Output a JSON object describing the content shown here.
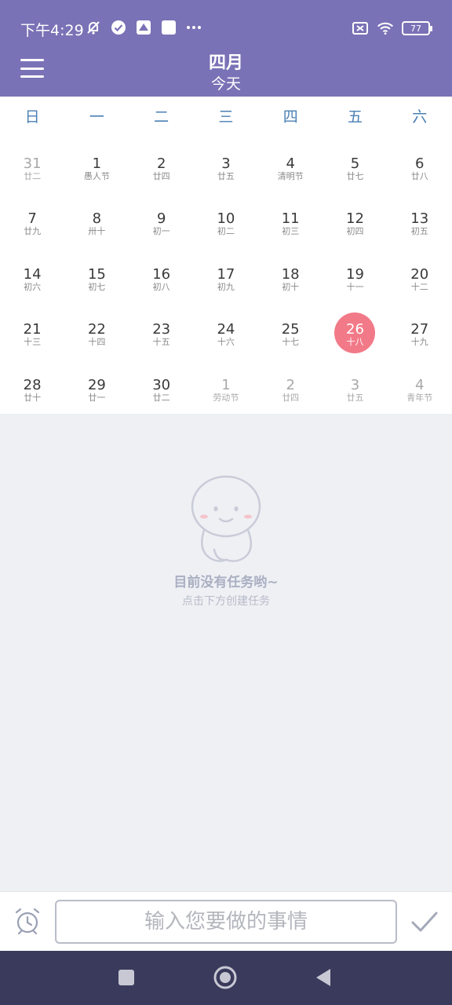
{
  "status": {
    "time": "下午4:29",
    "battery": "77"
  },
  "header": {
    "month_title": "四月",
    "today_label": "今天"
  },
  "weekdays": [
    "日",
    "一",
    "二",
    "三",
    "四",
    "五",
    "六"
  ],
  "calendar": {
    "weeks": [
      [
        {
          "day": "31",
          "lunar": "廿二",
          "other": true
        },
        {
          "day": "1",
          "lunar": "愚人节"
        },
        {
          "day": "2",
          "lunar": "廿四"
        },
        {
          "day": "3",
          "lunar": "廿五"
        },
        {
          "day": "4",
          "lunar": "清明节"
        },
        {
          "day": "5",
          "lunar": "廿七"
        },
        {
          "day": "6",
          "lunar": "廿八"
        }
      ],
      [
        {
          "day": "7",
          "lunar": "廿九"
        },
        {
          "day": "8",
          "lunar": "卅十"
        },
        {
          "day": "9",
          "lunar": "初一"
        },
        {
          "day": "10",
          "lunar": "初二"
        },
        {
          "day": "11",
          "lunar": "初三"
        },
        {
          "day": "12",
          "lunar": "初四"
        },
        {
          "day": "13",
          "lunar": "初五"
        }
      ],
      [
        {
          "day": "14",
          "lunar": "初六"
        },
        {
          "day": "15",
          "lunar": "初七"
        },
        {
          "day": "16",
          "lunar": "初八"
        },
        {
          "day": "17",
          "lunar": "初九"
        },
        {
          "day": "18",
          "lunar": "初十"
        },
        {
          "day": "19",
          "lunar": "十一"
        },
        {
          "day": "20",
          "lunar": "十二"
        }
      ],
      [
        {
          "day": "21",
          "lunar": "十三"
        },
        {
          "day": "22",
          "lunar": "十四"
        },
        {
          "day": "23",
          "lunar": "十五"
        },
        {
          "day": "24",
          "lunar": "十六"
        },
        {
          "day": "25",
          "lunar": "十七"
        },
        {
          "day": "26",
          "lunar": "十八",
          "today": true
        },
        {
          "day": "27",
          "lunar": "十九"
        }
      ],
      [
        {
          "day": "28",
          "lunar": "廿十"
        },
        {
          "day": "29",
          "lunar": "廿一"
        },
        {
          "day": "30",
          "lunar": "廿二"
        },
        {
          "day": "1",
          "lunar": "劳动节",
          "other": true
        },
        {
          "day": "2",
          "lunar": "廿四",
          "other": true
        },
        {
          "day": "3",
          "lunar": "廿五",
          "other": true
        },
        {
          "day": "4",
          "lunar": "青年节",
          "other": true
        }
      ]
    ]
  },
  "empty": {
    "title": "目前没有任务哟~",
    "subtitle": "点击下方创建任务"
  },
  "input": {
    "placeholder": "输入您要做的事情"
  },
  "colors": {
    "primary": "#7a72b6",
    "today_highlight": "#f27a88",
    "weekday_text": "#4a7fb4",
    "nav_bar": "#3a3a5c"
  }
}
